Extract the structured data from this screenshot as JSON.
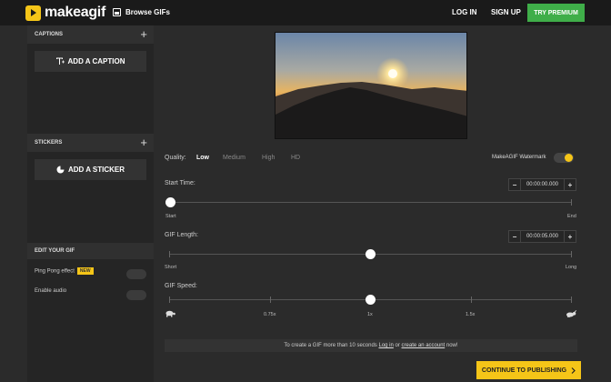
{
  "topbar": {
    "logo_text": "makeagif",
    "browse_label": "Browse GIFs",
    "login_label": "LOG IN",
    "signup_label": "SIGN UP",
    "premium_label": "TRY PREMIUM"
  },
  "sidebar": {
    "captions_title": "CAPTIONS",
    "add_caption_label": "ADD A CAPTION",
    "stickers_title": "STICKERS",
    "add_sticker_label": "ADD A STICKER",
    "edit_title": "EDIT YOUR GIF",
    "ping_pong_label": "Ping Pong effect",
    "new_badge": "NEW",
    "audio_label": "Enable audio",
    "ping_pong_enabled": false,
    "audio_enabled": false
  },
  "main": {
    "quality_label": "Quality:",
    "quality_options": [
      "Low",
      "Medium",
      "High",
      "HD"
    ],
    "quality_selected": "Low",
    "watermark_label": "MakeAGIF Watermark",
    "watermark_enabled": true,
    "start_time": {
      "label": "Start Time:",
      "value": "00:00:00.000",
      "min_label": "Start",
      "max_label": "End",
      "position": 0
    },
    "gif_length": {
      "label": "GIF Length:",
      "value": "00:00:05.000",
      "min_label": "Short",
      "max_label": "Long",
      "position": 0.5
    },
    "gif_speed": {
      "label": "GIF Speed:",
      "ticks": [
        "0.75x",
        "1x",
        "1.5x"
      ],
      "selected": "1x"
    },
    "info_prefix": "To create a GIF more than 10 seconds ",
    "info_login": "Log in",
    "info_middle": " or ",
    "info_create": "create an account",
    "info_suffix": " now!",
    "continue_label": "CONTINUE TO PUBLISHING"
  },
  "colors": {
    "accent": "#f5c518",
    "premium": "#3fae49"
  }
}
